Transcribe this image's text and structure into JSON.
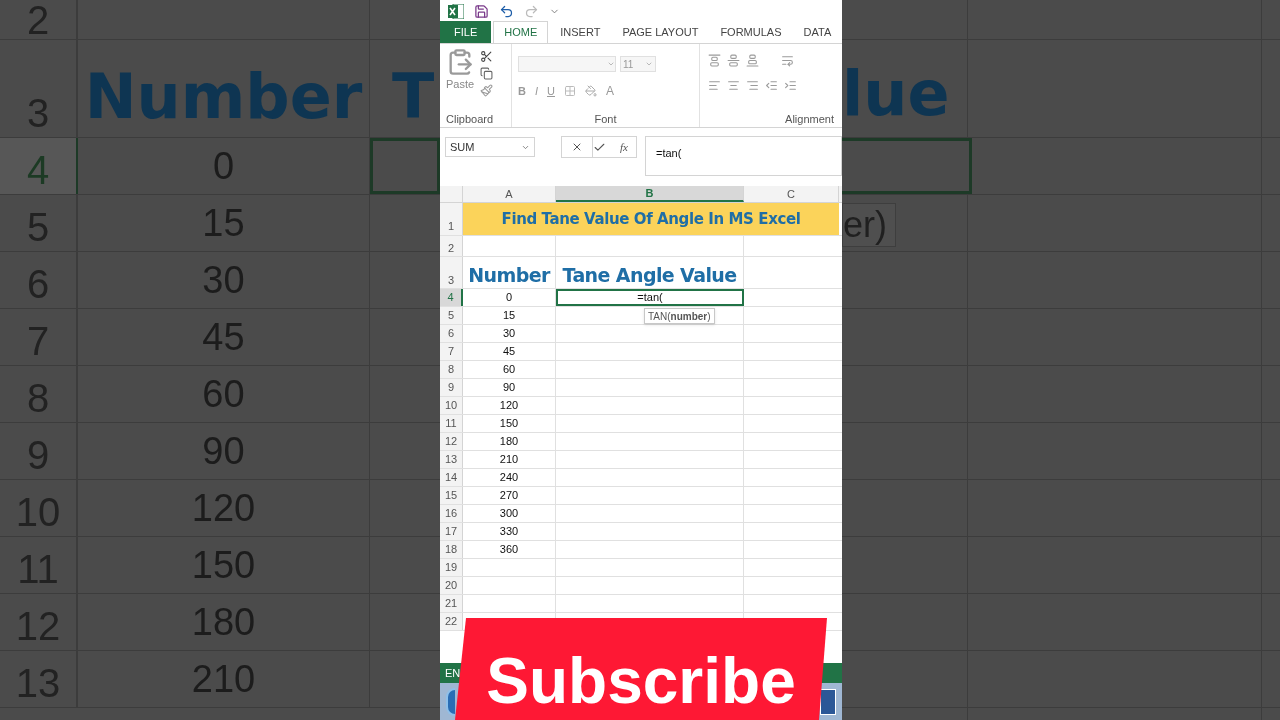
{
  "backdrop_left": {
    "rows": [
      {
        "number": "2",
        "selected": false
      },
      {
        "number": "3",
        "kind": "heading",
        "a": "Number",
        "b": "T",
        "selected": false
      },
      {
        "number": "4",
        "a": "0",
        "selected": true
      },
      {
        "number": "5",
        "a": "15",
        "selected": false
      },
      {
        "number": "6",
        "a": "30",
        "selected": false
      },
      {
        "number": "7",
        "a": "45",
        "selected": false
      },
      {
        "number": "8",
        "a": "60",
        "selected": false
      },
      {
        "number": "9",
        "a": "90",
        "selected": false
      },
      {
        "number": "10",
        "a": "120",
        "selected": false
      },
      {
        "number": "11",
        "a": "150",
        "selected": false
      },
      {
        "number": "12",
        "a": "180",
        "selected": false
      },
      {
        "number": "13",
        "a": "210",
        "selected": false
      }
    ]
  },
  "backdrop_right": {
    "heading_fragment": "lue",
    "tooltip_fragment": "er)"
  },
  "tabs": [
    {
      "label": "FILE",
      "kind": "file",
      "selected": false
    },
    {
      "label": "HOME",
      "selected": true
    },
    {
      "label": "INSERT",
      "selected": false
    },
    {
      "label": "PAGE LAYOUT",
      "selected": false
    },
    {
      "label": "FORMULAS",
      "selected": false
    },
    {
      "label": "DATA",
      "selected": false
    }
  ],
  "ribbon": {
    "paste_label": "Paste",
    "font_size": "11",
    "font_buttons": [
      "B",
      "I",
      "U"
    ],
    "font_color": "A",
    "groups": [
      "Clipboard",
      "Font",
      "Alignment"
    ]
  },
  "formula_bar": {
    "name_box": "SUM",
    "function_button": "fx",
    "formula": "=tan("
  },
  "columns": [
    {
      "label": "A",
      "selected": false
    },
    {
      "label": "B",
      "selected": true
    },
    {
      "label": "C",
      "selected": false
    }
  ],
  "sheet": {
    "top_row_numbers": [
      "1",
      "2",
      "3"
    ],
    "title": "Find Tane Value Of Angle In MS Excel",
    "heading_a": "Number",
    "heading_b": "Tane Angle Value",
    "rows": [
      {
        "number": "4",
        "a": "0",
        "b": "=tan(",
        "selected": true
      },
      {
        "number": "5",
        "a": "15",
        "selected": false
      },
      {
        "number": "6",
        "a": "30",
        "selected": false
      },
      {
        "number": "7",
        "a": "45",
        "selected": false
      },
      {
        "number": "8",
        "a": "60",
        "selected": false
      },
      {
        "number": "9",
        "a": "90",
        "selected": false
      },
      {
        "number": "10",
        "a": "120",
        "selected": false
      },
      {
        "number": "11",
        "a": "150",
        "selected": false
      },
      {
        "number": "12",
        "a": "180",
        "selected": false
      },
      {
        "number": "13",
        "a": "210",
        "selected": false
      },
      {
        "number": "14",
        "a": "240",
        "selected": false
      },
      {
        "number": "15",
        "a": "270",
        "selected": false
      },
      {
        "number": "16",
        "a": "300",
        "selected": false
      },
      {
        "number": "17",
        "a": "330",
        "selected": false
      },
      {
        "number": "18",
        "a": "360",
        "selected": false
      },
      {
        "number": "19",
        "selected": false
      },
      {
        "number": "20",
        "selected": false
      },
      {
        "number": "21",
        "selected": false
      },
      {
        "number": "22",
        "selected": false
      }
    ],
    "tooltip": "TAN(**number**)"
  },
  "status_bar": "EN",
  "banner": "Subscribe"
}
